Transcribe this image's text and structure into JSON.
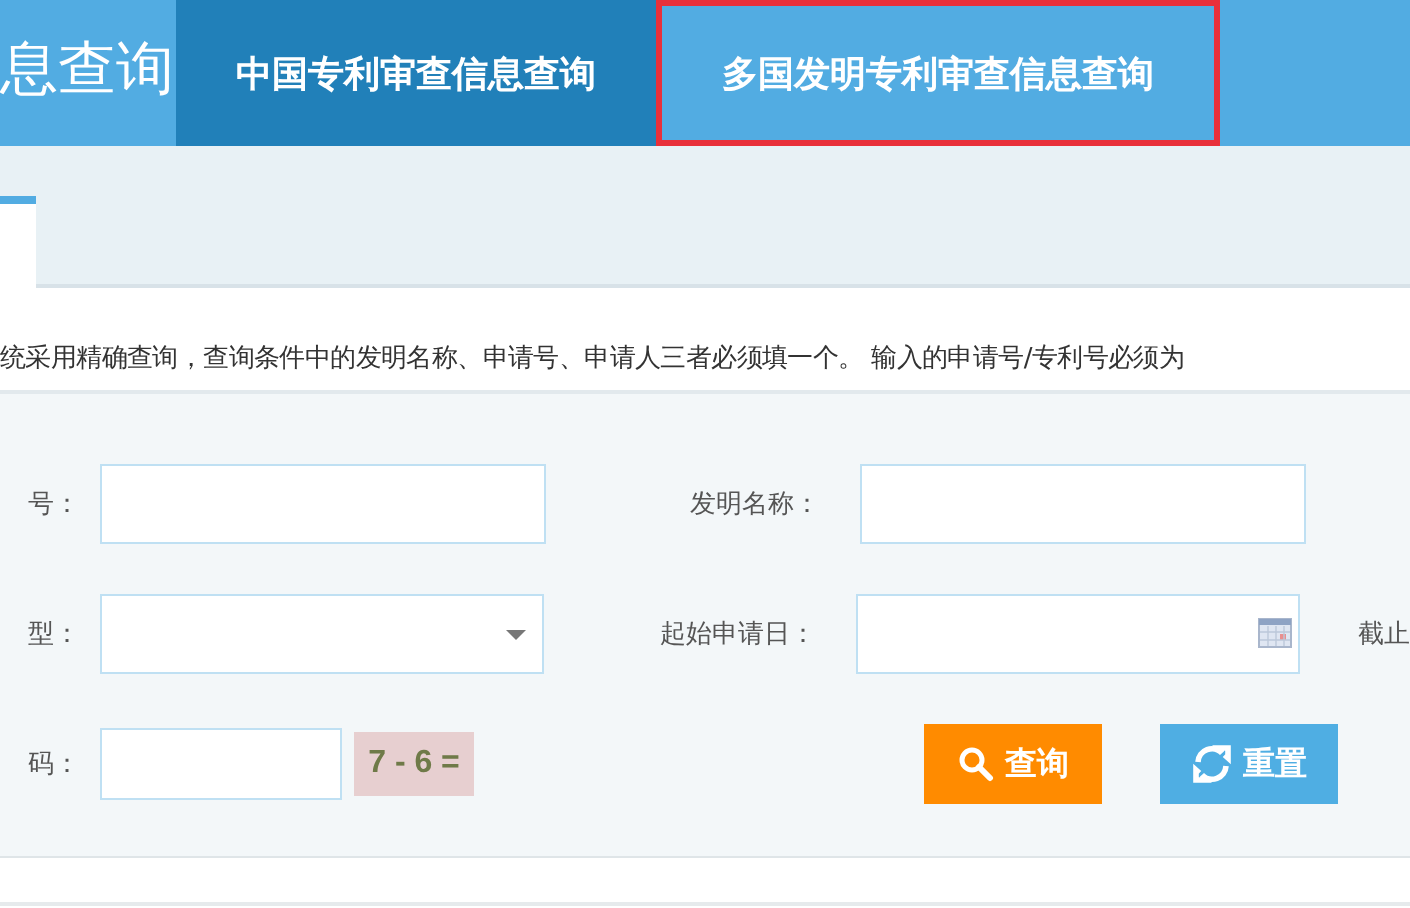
{
  "header": {
    "logo_text": "息查询",
    "tabs": [
      {
        "label": "中国专利审查信息查询",
        "selected": true,
        "highlighted": false
      },
      {
        "label": "多国发明专利审查信息查询",
        "selected": false,
        "highlighted": true
      }
    ]
  },
  "subtab": {
    "selected": true
  },
  "notice": "统采用精确查询，查询条件中的发明名称、申请号、申请人三者必须填一个。 输入的申请号/专利号必须为",
  "form": {
    "rows": [
      [
        {
          "label": "号：",
          "kind": "text"
        },
        {
          "label": "发明名称：",
          "kind": "text"
        }
      ],
      [
        {
          "label": "型：",
          "kind": "select"
        },
        {
          "label": "起始申请日：",
          "kind": "date"
        },
        {
          "label": "截止",
          "kind": "label"
        }
      ],
      [
        {
          "label": "码：",
          "kind": "captcha",
          "captcha": "7 - 6 ="
        }
      ]
    ],
    "buttons": [
      {
        "label": "查询",
        "kind": "search"
      },
      {
        "label": "重置",
        "kind": "reset"
      }
    ]
  }
}
